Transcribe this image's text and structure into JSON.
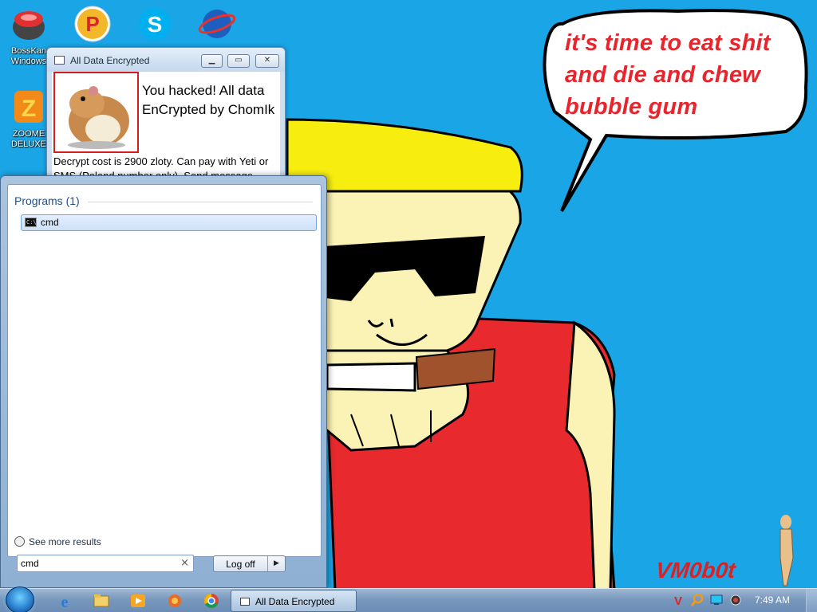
{
  "wallpaper": {
    "speech_bubble": "it's time to eat shit and die and chew bubble gum",
    "signature": "VM0b0t"
  },
  "desktop_icons": [
    {
      "label": "BossKan\nWindows",
      "icon": "bosskan-app-icon"
    },
    {
      "label": "",
      "icon": "p-app-icon"
    },
    {
      "label": "",
      "icon": "skype-icon"
    },
    {
      "label": "",
      "icon": "globe-browser-icon"
    },
    {
      "label": "ZOOME\nDELUXE",
      "icon": "zoome-deluxe-icon"
    }
  ],
  "ransom_window": {
    "title": "All Data Encrypted",
    "heading": "You hacked! All data EnCrypted by ChomIk",
    "body": "Decrypt cost is 2900 zloty. Can pay with Yeti or SMS (Poland number only). Send message"
  },
  "start_menu": {
    "group_heading": "Programs (1)",
    "results": [
      {
        "label": "cmd",
        "icon": "cmd-icon"
      }
    ],
    "see_more": "See more results",
    "search_value": "cmd",
    "clear_symbol": "×",
    "logoff_label": "Log off",
    "logoff_arrow": "▶"
  },
  "taskbar": {
    "pinned": [
      "internet-explorer-icon",
      "file-explorer-icon",
      "media-player-icon",
      "app-icon",
      "chrome-icon"
    ],
    "tasks": [
      {
        "label": "All Data Encrypted"
      }
    ],
    "tray": [
      "v-icon",
      "search-tray-icon",
      "monitor-icon",
      "speaker-icon"
    ],
    "clock": "7:49 AM"
  },
  "colors": {
    "desktop_bg": "#1aa6e6",
    "bubble_text": "#e8252c",
    "hamster_border": "#d51d1d",
    "shirt": "#e82a2f",
    "hat": "#f7ee10",
    "skin": "#fbf3b5"
  }
}
